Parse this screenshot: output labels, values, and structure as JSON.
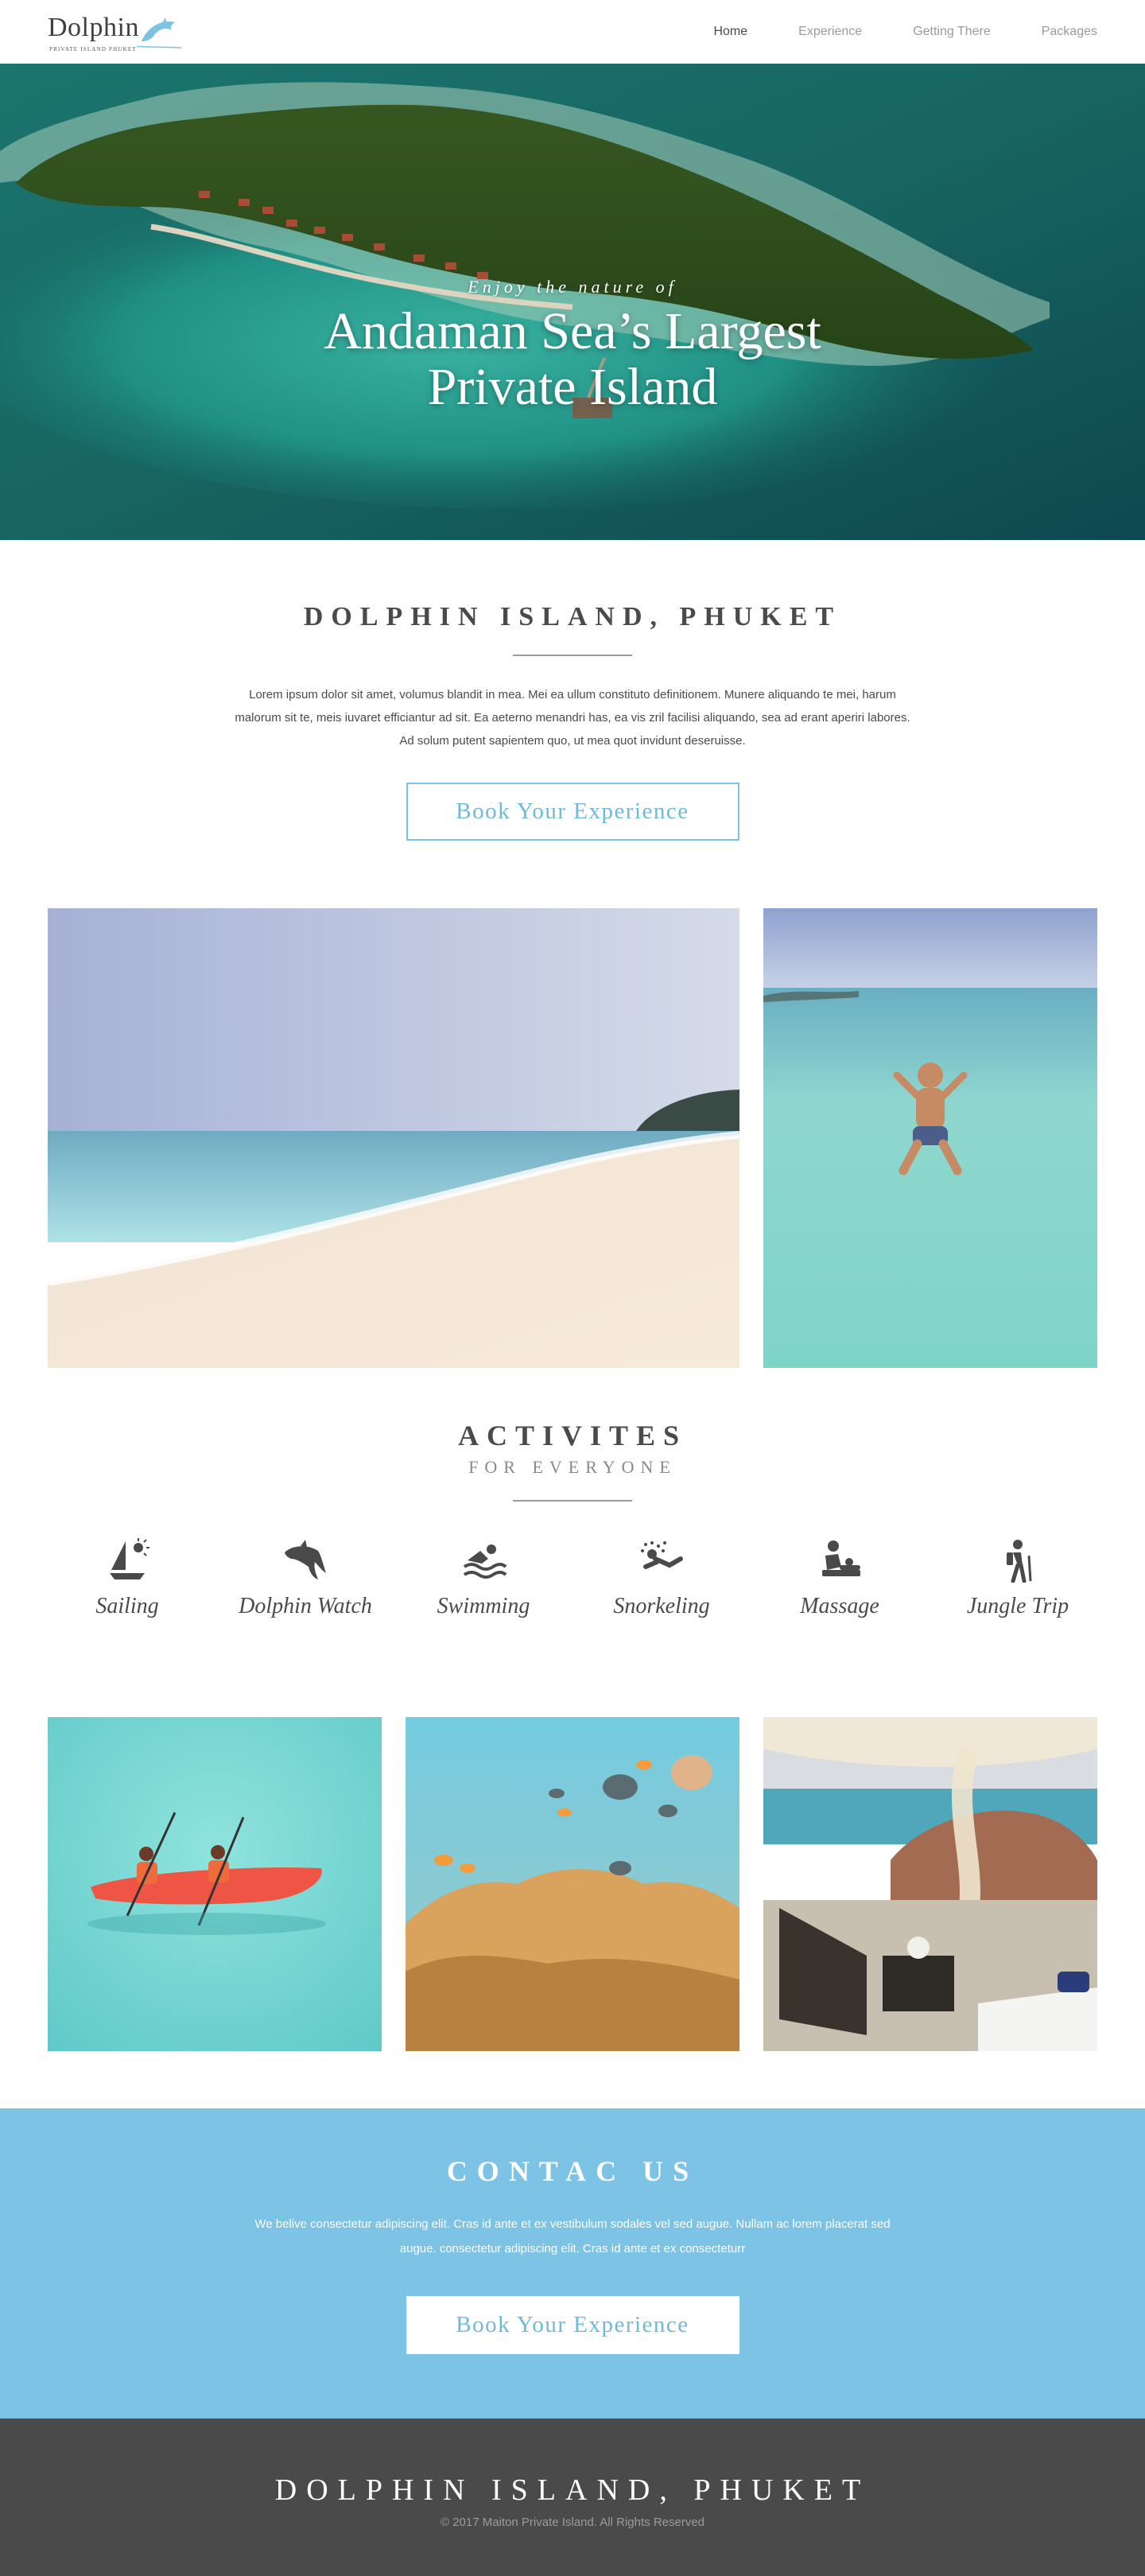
{
  "header": {
    "logo_text": "Dolphin",
    "logo_subtitle": "PRIVATE ISLAND PHUKET",
    "nav": [
      {
        "label": "Home",
        "active": true
      },
      {
        "label": "Experience",
        "active": false
      },
      {
        "label": "Getting There",
        "active": false
      },
      {
        "label": "Packages",
        "active": false
      }
    ]
  },
  "hero": {
    "kicker": "Enjoy the nature of",
    "title_line1": "Andaman Sea’s Largest",
    "title_line2": "Private Island"
  },
  "intro": {
    "title": "DOLPHIN ISLAND, PHUKET",
    "text": "Lorem ipsum dolor sit amet, volumus blandit in mea. Mei ea ullum constituto definitionem. Munere aliquando te mei, harum malorum sit te, meis iuvaret efficiantur ad sit. Ea aeterno menandri has, ea vis zril facilisi aliquando, sea ad erant aperiri labores. Ad solum putent sapientem quo, ut mea quot invidunt deseruisse.",
    "button": "Book Your Experience"
  },
  "activities": {
    "title": "ACTIVITES",
    "subtitle": "FOR EVERYONE",
    "items": [
      {
        "label": "Sailing",
        "icon": "sailing-icon"
      },
      {
        "label": "Dolphin Watch",
        "icon": "dolphin-icon"
      },
      {
        "label": "Swimming",
        "icon": "swimming-icon"
      },
      {
        "label": "Snorkeling",
        "icon": "snorkeling-icon"
      },
      {
        "label": "Massage",
        "icon": "massage-icon"
      },
      {
        "label": "Jungle Trip",
        "icon": "hiking-icon"
      }
    ]
  },
  "contact": {
    "title": "CONTAC US",
    "text_line1": "We belive consectetur adipiscing elit. Cras id ante et ex vestibulum sodales vel sed augue. Nullam ac lorem placerat sed",
    "text_line2": "augue. consectetur adipiscing elit. Cras id ante et ex consecteturr",
    "button": "Book Your Experience"
  },
  "footer": {
    "title": "DOLPHIN ISLAND, PHUKET",
    "copyright": "© 2017 Maiton Private Island. All Rights Reserved"
  },
  "colors": {
    "accent": "#7cc3e6",
    "text": "#4a4a4a",
    "muted": "#9b9b9b",
    "footer_bg": "#4a4a4a"
  }
}
